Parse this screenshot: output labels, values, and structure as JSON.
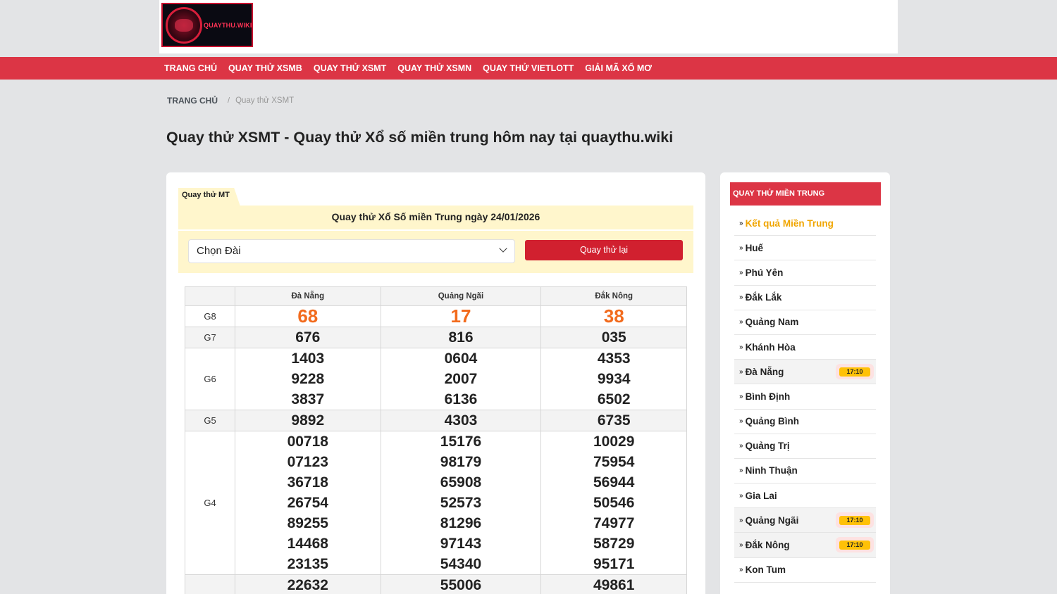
{
  "logo": {
    "text": "QUAYTHU.WIKI"
  },
  "nav": [
    "TRANG CHỦ",
    "QUAY THỬ XSMB",
    "QUAY THỬ XSMT",
    "QUAY THỬ XSMN",
    "QUAY THỬ VIETLOTT",
    "GIẢI MÃ XỔ MƠ"
  ],
  "breadcrumb": {
    "home": "TRANG CHỦ",
    "separator": "/",
    "current": "Quay thử XSMT"
  },
  "page_title": "Quay thử XSMT - Quay thử Xổ số miền trung hôm nay tại quaythu.wiki",
  "panel": {
    "tab_label": "Quay thử MT",
    "title": "Quay thử Xổ Số miền Trung ngày 24/01/2026",
    "select_value": "Chọn Đài",
    "retry_button": "Quay thử lại"
  },
  "results": {
    "columns": [
      "Đà Nẵng",
      "Quảng Ngãi",
      "Đắk Nông"
    ],
    "rows": [
      {
        "prize": "G8",
        "values": [
          [
            "68"
          ],
          [
            "17"
          ],
          [
            "38"
          ]
        ]
      },
      {
        "prize": "G7",
        "values": [
          [
            "676"
          ],
          [
            "816"
          ],
          [
            "035"
          ]
        ]
      },
      {
        "prize": "G6",
        "values": [
          [
            "1403",
            "9228",
            "3837"
          ],
          [
            "0604",
            "2007",
            "6136"
          ],
          [
            "4353",
            "9934",
            "6502"
          ]
        ]
      },
      {
        "prize": "G5",
        "values": [
          [
            "9892"
          ],
          [
            "4303"
          ],
          [
            "6735"
          ]
        ]
      },
      {
        "prize": "G4",
        "values": [
          [
            "00718",
            "07123",
            "36718",
            "26754",
            "89255",
            "14468",
            "23135"
          ],
          [
            "15176",
            "98179",
            "65908",
            "52573",
            "81296",
            "97143",
            "54340"
          ],
          [
            "10029",
            "75954",
            "56944",
            "50546",
            "74977",
            "58729",
            "95171"
          ]
        ]
      },
      {
        "prize": "",
        "values": [
          [
            "22632"
          ],
          [
            "55006"
          ],
          [
            "49861"
          ]
        ]
      }
    ]
  },
  "sidebar": {
    "heading": "QUAY THỬ MIỀN TRUNG",
    "items": [
      {
        "label": "Kết quả Miền Trung",
        "badge": null
      },
      {
        "label": "Huế",
        "badge": null
      },
      {
        "label": "Phú Yên",
        "badge": null
      },
      {
        "label": "Đắk Lắk",
        "badge": null
      },
      {
        "label": "Quảng Nam",
        "badge": null
      },
      {
        "label": "Khánh Hòa",
        "badge": null
      },
      {
        "label": "Đà Nẵng",
        "badge": "17:10"
      },
      {
        "label": "Bình Định",
        "badge": null
      },
      {
        "label": "Quảng Bình",
        "badge": null
      },
      {
        "label": "Quảng Trị",
        "badge": null
      },
      {
        "label": "Ninh Thuận",
        "badge": null
      },
      {
        "label": "Gia Lai",
        "badge": null
      },
      {
        "label": "Quảng Ngãi",
        "badge": "17:10"
      },
      {
        "label": "Đắk Nông",
        "badge": "17:10"
      },
      {
        "label": "Kon Tum",
        "badge": null
      }
    ]
  },
  "colors": {
    "brand_red": "#dc3545",
    "button_red": "#d1202f",
    "highlight_orange": "#f26b1d",
    "badge_yellow": "#ffc107",
    "panel_yellow": "#fff6cc",
    "link_gold": "#f0a500"
  }
}
